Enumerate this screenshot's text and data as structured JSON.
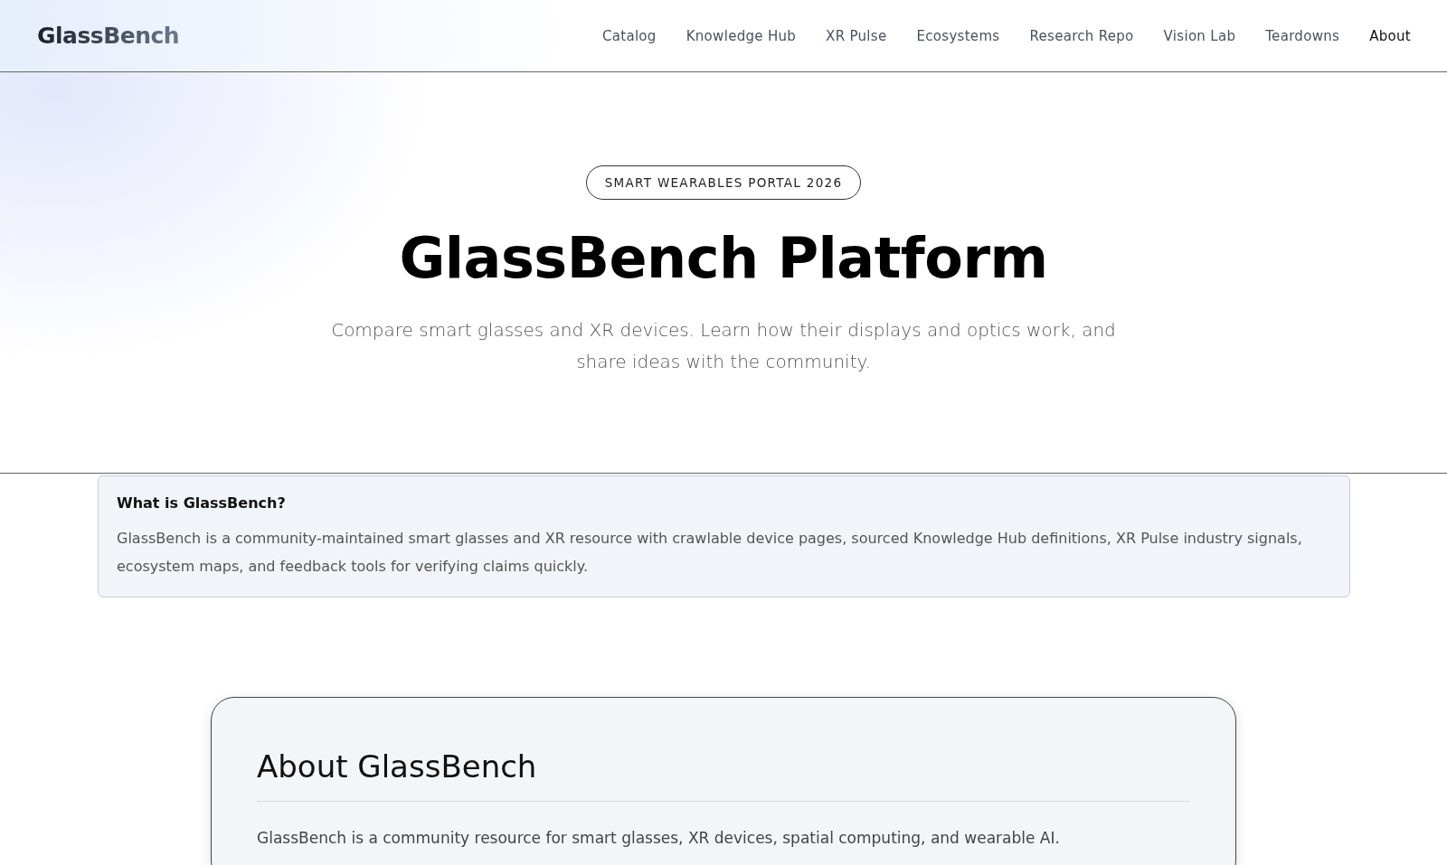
{
  "header": {
    "logo": "GlassBench",
    "nav": [
      {
        "label": "Catalog",
        "selected": false
      },
      {
        "label": "Knowledge Hub",
        "selected": false
      },
      {
        "label": "XR Pulse",
        "selected": false
      },
      {
        "label": "Ecosystems",
        "selected": false
      },
      {
        "label": "Research Repo",
        "selected": false
      },
      {
        "label": "Vision Lab",
        "selected": false
      },
      {
        "label": "Teardowns",
        "selected": false
      },
      {
        "label": "About",
        "selected": true
      }
    ]
  },
  "hero": {
    "badge": "SMART WEARABLES PORTAL 2026",
    "title": "GlassBench Platform",
    "subtitle": "Compare smart glasses and XR devices. Learn how their displays and optics work, and share ideas with the community."
  },
  "info_card": {
    "title": "What is GlassBench?",
    "text": "GlassBench is a community-maintained smart glasses and XR resource with crawlable device pages, sourced Knowledge Hub definitions, XR Pulse industry signals, ecosystem maps, and feedback tools for verifying claims quickly."
  },
  "about": {
    "title": "About GlassBench",
    "text": "GlassBench is a community resource for smart glasses, XR devices, spatial computing, and wearable AI."
  }
}
